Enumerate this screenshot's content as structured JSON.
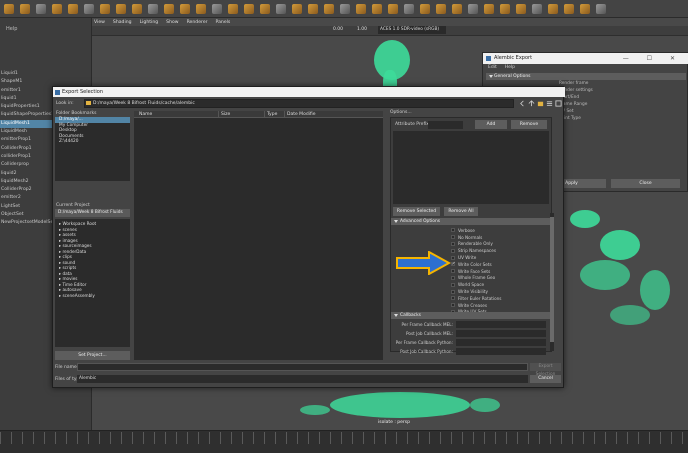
{
  "maya": {
    "menu_help": "Help",
    "outliner_items": [
      "Liquid1",
      "ShapeM1",
      "emitter1",
      "liquid1",
      "liquidProperties1",
      "liquidShapeProperties1",
      "LiquidMesh1",
      "LiquidMesh",
      "emitterProp1",
      "ColliderProp1",
      "colliderProp1",
      "Colliderprop",
      "liquid2",
      "liquidMesh2",
      "ColliderProp2",
      "emitter2",
      "LightSet",
      "ObjectSet",
      "NewProjectsetModelSet"
    ],
    "outliner_selected_index": 6,
    "viewport_menu": [
      "View",
      "Shading",
      "Lighting",
      "Show",
      "Renderer",
      "Panels"
    ],
    "value_a": "0.00",
    "value_b": "1.00",
    "color_space": "ACES 1.0 SDR-video (sRGB)",
    "camera_label": "isolate : persp",
    "accent_color": "#3ddb9a"
  },
  "alembic": {
    "title": "Alembic Export",
    "menu": [
      "Edit",
      "Help"
    ],
    "general_section": "General Options",
    "side_texts": [
      "Render frame",
      "Render settings",
      "Start/End",
      "Frame Range",
      "UV Set",
      "Point Type"
    ],
    "apply_label": "Apply",
    "close_label": "Close"
  },
  "dialog": {
    "title": "Export Selection",
    "look_in_label": "Look in:",
    "look_in_path": "D:/maya/Week 8 Bifrost Fluids/cache/alembic",
    "folder_bookmarks_label": "Folder Bookmarks",
    "bookmarks": [
      "D:/maya/...",
      "My Computer",
      "Desktop",
      "Documents",
      "Z:\\44420"
    ],
    "bookmark_selected_index": 0,
    "current_project_label": "Current Project",
    "current_project": "D:/maya/Week 8 Bifrost Fluids",
    "project_folders": [
      "Workspace Root",
      "scenes",
      "assets",
      "images",
      "sourceimages",
      "renderData",
      "clips",
      "sound",
      "scripts",
      "data",
      "movies",
      "Time Editor",
      "autosave",
      "sceneAssembly"
    ],
    "set_project_label": "Set Project...",
    "columns": [
      "Name",
      "Size",
      "Type",
      "Date Modifie"
    ],
    "options_label": "Options...",
    "attribute_prefix_label": "Attribute Prefix",
    "add_label": "Add",
    "remove_label": "Remove",
    "remove_selected_label": "Remove Selected",
    "remove_all_label": "Remove All",
    "advanced_options_label": "Advanced Options",
    "advanced_checkboxes": [
      {
        "label": "Verbose",
        "checked": false
      },
      {
        "label": "No Normals",
        "checked": false
      },
      {
        "label": "Renderable Only",
        "checked": false
      },
      {
        "label": "Strip Namespaces",
        "checked": false
      },
      {
        "label": "UV Write",
        "checked": false
      },
      {
        "label": "Write Color Sets",
        "checked": true
      },
      {
        "label": "Write Face Sets",
        "checked": false
      },
      {
        "label": "Whole Frame Geo",
        "checked": false
      },
      {
        "label": "World Space",
        "checked": false
      },
      {
        "label": "Write Visibility",
        "checked": false
      },
      {
        "label": "Filter Euler Rotations",
        "checked": false
      },
      {
        "label": "Write Creases",
        "checked": false
      },
      {
        "label": "Write UV Sets",
        "checked": false
      }
    ],
    "callbacks_label": "Callbacks",
    "callbacks": [
      "Per Frame Callback MEL:",
      "Post Job Callback MEL:",
      "Per Frame Callback Python:",
      "Post Job Callback Python:"
    ],
    "file_name_label": "File name:",
    "file_name_value": "",
    "export_label": "Export Selection",
    "files_of_type_label": "Files of type:",
    "files_of_type_value": "Alembic",
    "cancel_label": "Cancel"
  },
  "annotation": {
    "arrow_color": "#f5b400",
    "arrow_fill": "#2c6fd0"
  }
}
